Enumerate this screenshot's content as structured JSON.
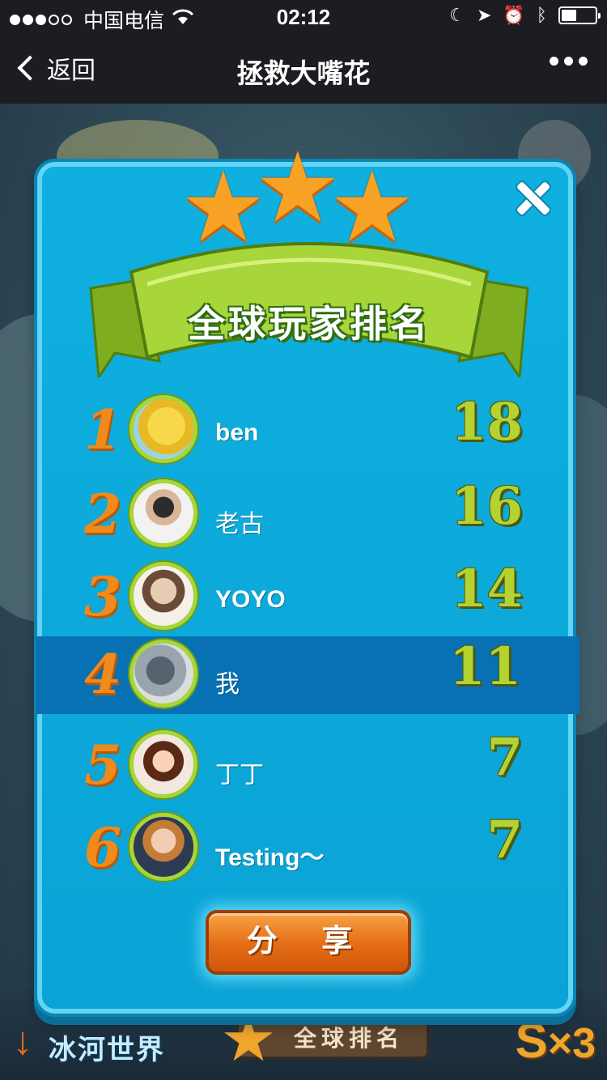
{
  "status_bar": {
    "carrier": "中国电信",
    "time": "02:12"
  },
  "nav": {
    "back_label": "返回",
    "title": "拯救大嘴花"
  },
  "panel": {
    "title": "全球玩家排名",
    "share_label": "分 享",
    "rows": [
      {
        "rank": "1",
        "name": "ben",
        "score": "18"
      },
      {
        "rank": "2",
        "name": "老古",
        "score": "16"
      },
      {
        "rank": "3",
        "name": "YOYO",
        "score": "14"
      },
      {
        "rank": "4",
        "name": "我",
        "score": "11"
      },
      {
        "rank": "5",
        "name": "丁丁",
        "score": "7"
      },
      {
        "rank": "6",
        "name": "Testing～",
        "score": "7"
      }
    ]
  },
  "bottom_bar": {
    "world_label": "冰河世界",
    "rank_label": "全球排名",
    "lives": "×3"
  },
  "colors": {
    "panel": "#0ba6d8",
    "highlight_row": "#0771b4",
    "rank_orange": "#f08a1c",
    "score_green": "#b5d233",
    "ribbon_green": "#a7d53a"
  }
}
